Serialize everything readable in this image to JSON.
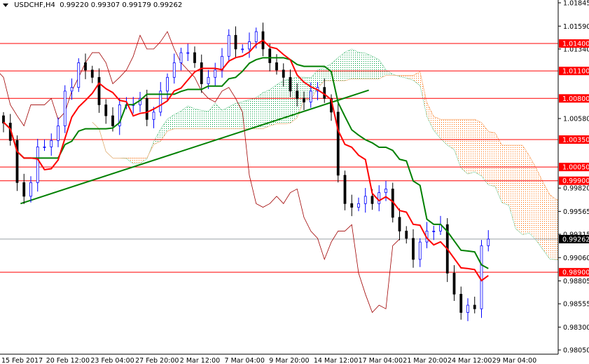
{
  "header": {
    "symbol": "USDCHF,H4",
    "open": "0.99220",
    "high": "0.99307",
    "low": "0.99179",
    "close": "0.99262"
  },
  "colors": {
    "up": "#0000ff",
    "down": "#000000",
    "tenkan": "#ff0000",
    "kijun": "#008000",
    "chikou": "#a00000",
    "cloud_bull": "#00a040",
    "cloud_bear": "#ff6a00",
    "level": "#ff0000",
    "bid": "#000000",
    "trend": "#008000"
  },
  "chart_data": {
    "type": "line",
    "title": "USDCHF,H4",
    "xlabel": "",
    "ylabel": "",
    "ylim": [
      0.9805,
      1.01845
    ],
    "x_tick_labels": [
      "15 Feb 2017",
      "20 Feb 12:00",
      "23 Feb 04:00",
      "27 Feb 20:00",
      "2 Mar 12:00",
      "7 Mar 04:00",
      "9 Mar 20:00",
      "14 Mar 12:00",
      "17 Mar 04:00",
      "21 Mar 20:00",
      "24 Mar 12:00",
      "29 Mar 04:00"
    ],
    "y_tick_labels": [
      "1.01845",
      "1.01590",
      "1.01340",
      "1.00580",
      "0.99820",
      "0.99565",
      "0.99315",
      "0.99060",
      "0.98805",
      "0.98555",
      "0.98300",
      "0.98050"
    ],
    "close": [
      1.0053,
      1.0034,
      0.9988,
      0.9973,
      0.9988,
      1.0027,
      1.0027,
      1.0034,
      1.005,
      1.0088,
      1.0092,
      1.0119,
      1.0111,
      1.0103,
      1.0073,
      1.0061,
      1.005,
      1.0073,
      1.0073,
      1.0073,
      1.008,
      1.0057,
      1.0065,
      1.0088,
      1.0103,
      1.0119,
      1.013,
      1.013,
      1.0119,
      1.0096,
      1.0103,
      1.0111,
      1.0126,
      1.0149,
      1.0134,
      1.0134,
      1.0142,
      1.0153,
      1.0134,
      1.0119,
      1.0111,
      1.0103,
      1.0088,
      1.008,
      1.0076,
      1.0088,
      1.0092,
      1.008,
      1.0065,
      0.9996,
      0.9965,
      0.9961,
      0.9965,
      0.9973,
      0.9965,
      0.9977,
      0.9981,
      0.995,
      0.9935,
      0.9927,
      0.9904,
      0.9923,
      0.9935,
      0.9935,
      0.9942,
      0.9889,
      0.9866,
      0.9846,
      0.9854,
      0.985,
      0.9919,
      0.99262
    ],
    "levels": [
      {
        "label": "1.01400",
        "value": 1.014
      },
      {
        "label": "1.01100",
        "value": 1.011
      },
      {
        "label": "1.00800",
        "value": 1.008
      },
      {
        "label": "1.00350",
        "value": 1.0035
      },
      {
        "label": "1.00050",
        "value": 1.0005
      },
      {
        "label": "0.99900",
        "value": 0.999
      },
      {
        "label": "0.98900",
        "value": 0.989
      }
    ],
    "bid": {
      "label": "0.99262",
      "value": 0.99262
    },
    "trendline": {
      "from": {
        "bar": 2.5,
        "price": 0.9965
      },
      "to": {
        "bar": 53.5,
        "price": 1.0089
      }
    },
    "ichimoku": {
      "tenkan": 5,
      "kijun": 13,
      "shift": 13
    }
  }
}
